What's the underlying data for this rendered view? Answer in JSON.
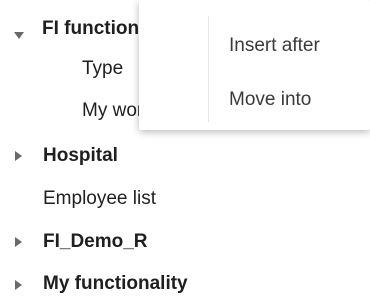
{
  "tree": {
    "nodes": [
      {
        "label": "FI functionality",
        "bold": true,
        "expanded": true
      },
      {
        "label": "Type",
        "bold": false
      },
      {
        "label": "My workspace",
        "bold": false
      },
      {
        "label": "Hospital",
        "bold": true,
        "expanded": false
      },
      {
        "label": "Employee list",
        "bold": false
      },
      {
        "label": "FI_Demo_R",
        "bold": true,
        "expanded": false
      },
      {
        "label": "My functionality",
        "bold": true,
        "expanded": false
      }
    ]
  },
  "context_menu": {
    "items": [
      {
        "label": "Insert after"
      },
      {
        "label": "Move into"
      }
    ]
  }
}
